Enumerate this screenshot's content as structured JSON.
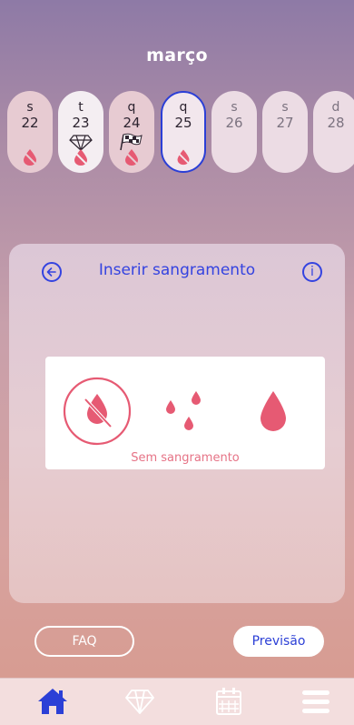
{
  "header": {
    "month": "março"
  },
  "days": [
    {
      "letter": "s",
      "number": "22"
    },
    {
      "letter": "t",
      "number": "23"
    },
    {
      "letter": "q",
      "number": "24"
    },
    {
      "letter": "q",
      "number": "25"
    },
    {
      "letter": "s",
      "number": "26"
    },
    {
      "letter": "s",
      "number": "27"
    },
    {
      "letter": "d",
      "number": "28"
    }
  ],
  "panel": {
    "title": "Inserir sangramento",
    "back_icon": "arrow-left-circle-icon",
    "info_icon": "info-circle-icon",
    "info_label": "i",
    "options_caption": "Sem sangramento",
    "options": [
      "no-bleeding-icon",
      "spotting-drops-icon",
      "bleeding-drop-icon"
    ]
  },
  "buttons": {
    "faq": "FAQ",
    "forecast": "Previsão"
  },
  "nav": {
    "items": [
      "home-icon",
      "diamond-icon",
      "calendar-icon",
      "menu-icon"
    ]
  },
  "colors": {
    "accent": "#3443e0",
    "drop": "#e65a73",
    "caption": "#e67386",
    "header_text": "#ffffff"
  }
}
